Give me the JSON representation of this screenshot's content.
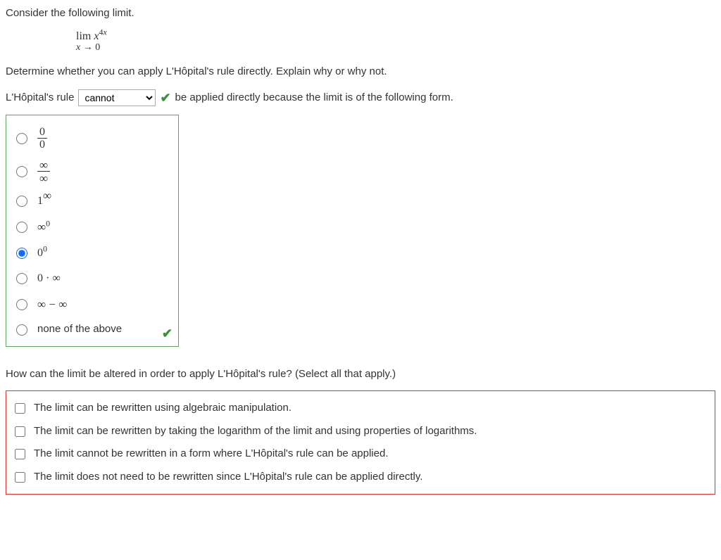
{
  "q1_intro": "Consider the following limit.",
  "limit": {
    "top_prefix": "lim ",
    "top_var": "x",
    "top_exp_num": "4",
    "top_exp_var": "x",
    "bottom_var": "x",
    "bottom_arrow": " → 0"
  },
  "q2_text": "Determine whether you can apply L'Hôpital's rule directly. Explain why or why not.",
  "rule_sentence_prefix": "L'Hôpital's rule",
  "dropdown_selected": "cannot",
  "rule_sentence_suffix": "be applied directly because the limit is of the following form.",
  "radio": {
    "opt1_num": "0",
    "opt1_den": "0",
    "opt2_num": "∞",
    "opt2_den": "∞",
    "opt3_base": "1",
    "opt3_exp": "∞",
    "opt4_base": "∞",
    "opt4_exp": "0",
    "opt5_base": "0",
    "opt5_exp": "0",
    "opt6": "0 · ∞",
    "opt7": "∞ − ∞",
    "opt8": "none of the above"
  },
  "q3_text": "How can the limit be altered in order to apply L'Hôpital's rule? (Select all that apply.)",
  "checks": {
    "c1": "The limit can be rewritten using algebraic manipulation.",
    "c2": "The limit can be rewritten by taking the logarithm of the limit and using properties of logarithms.",
    "c3": "The limit cannot be rewritten in a form where L'Hôpital's rule can be applied.",
    "c4": "The limit does not need to be rewritten since L'Hôpital's rule can be applied directly."
  }
}
